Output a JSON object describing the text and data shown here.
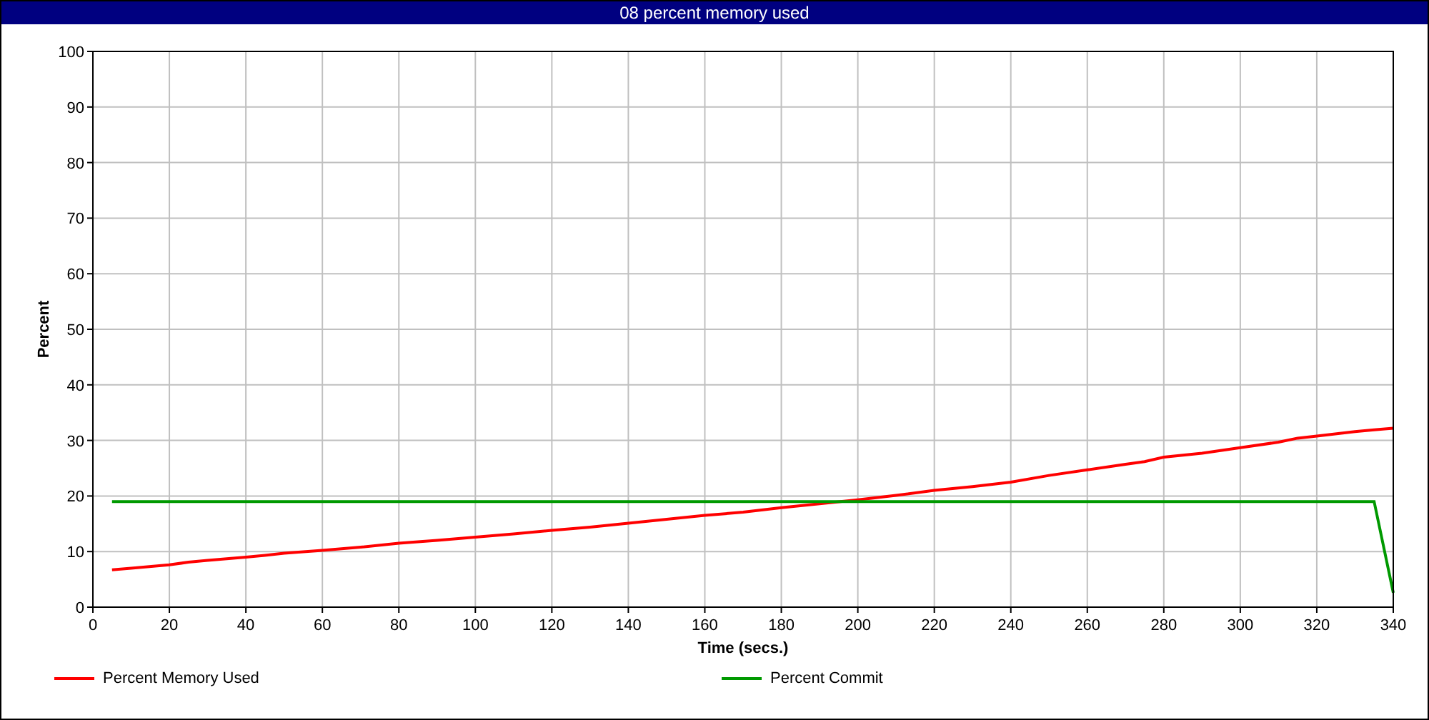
{
  "window": {
    "title": "08 percent memory used"
  },
  "chart": {
    "chart_data": {
      "type": "line",
      "xlabel": "Time (secs.)",
      "ylabel": "Percent",
      "x": [
        5,
        10,
        20,
        25,
        30,
        40,
        45,
        50,
        60,
        70,
        80,
        90,
        100,
        110,
        120,
        130,
        140,
        150,
        160,
        170,
        180,
        190,
        200,
        210,
        220,
        230,
        240,
        250,
        260,
        270,
        275,
        280,
        290,
        300,
        310,
        315,
        320,
        330,
        335,
        340
      ],
      "series": [
        {
          "name": "Percent Memory Used",
          "color": "#ff0000",
          "values": [
            6.7,
            7.0,
            7.6,
            8.1,
            8.4,
            9.0,
            9.3,
            9.7,
            10.2,
            10.8,
            11.5,
            12.0,
            12.6,
            13.2,
            13.8,
            14.4,
            15.1,
            15.8,
            16.5,
            17.1,
            17.9,
            18.6,
            19.3,
            20.1,
            21.0,
            21.7,
            22.5,
            23.7,
            24.7,
            25.7,
            26.2,
            27.0,
            27.7,
            28.7,
            29.7,
            30.4,
            30.8,
            31.6,
            31.9,
            32.2
          ]
        },
        {
          "name": "Percent Commit",
          "color": "#009900",
          "values": [
            19,
            19,
            19,
            19,
            19,
            19,
            19,
            19,
            19,
            19,
            19,
            19,
            19,
            19,
            19,
            19,
            19,
            19,
            19,
            19,
            19,
            19,
            19,
            19,
            19,
            19,
            19,
            19,
            19,
            19,
            19,
            19,
            19,
            19,
            19,
            19,
            19,
            19,
            19,
            2.6
          ]
        }
      ],
      "grid": true,
      "xlim": [
        0,
        340
      ],
      "ylim": [
        0,
        100
      ],
      "xticks": [
        0,
        20,
        40,
        60,
        80,
        100,
        120,
        140,
        160,
        180,
        200,
        220,
        240,
        260,
        280,
        300,
        320,
        340
      ],
      "yticks": [
        0,
        10,
        20,
        30,
        40,
        50,
        60,
        70,
        80,
        90,
        100
      ]
    }
  }
}
